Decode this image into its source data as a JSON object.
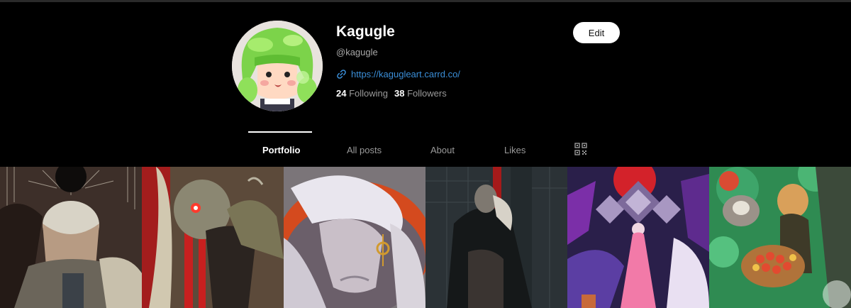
{
  "profile": {
    "name": "Kagugle",
    "handle": "@kagugle",
    "link": "https://kagugleart.carrd.co/",
    "following_count": "24",
    "following_label": "Following",
    "followers_count": "38",
    "followers_label": "Followers",
    "edit_label": "Edit"
  },
  "tabs": [
    {
      "label": "Portfolio",
      "active": true
    },
    {
      "label": "All posts"
    },
    {
      "label": "About"
    },
    {
      "label": "Likes"
    }
  ],
  "icons": {
    "link": "link-icon",
    "qr": "qr-code-icon"
  },
  "colors": {
    "background": "#000000",
    "link": "#3b8fd9",
    "muted": "#9a9a9a",
    "edit_bg": "#ffffff"
  }
}
